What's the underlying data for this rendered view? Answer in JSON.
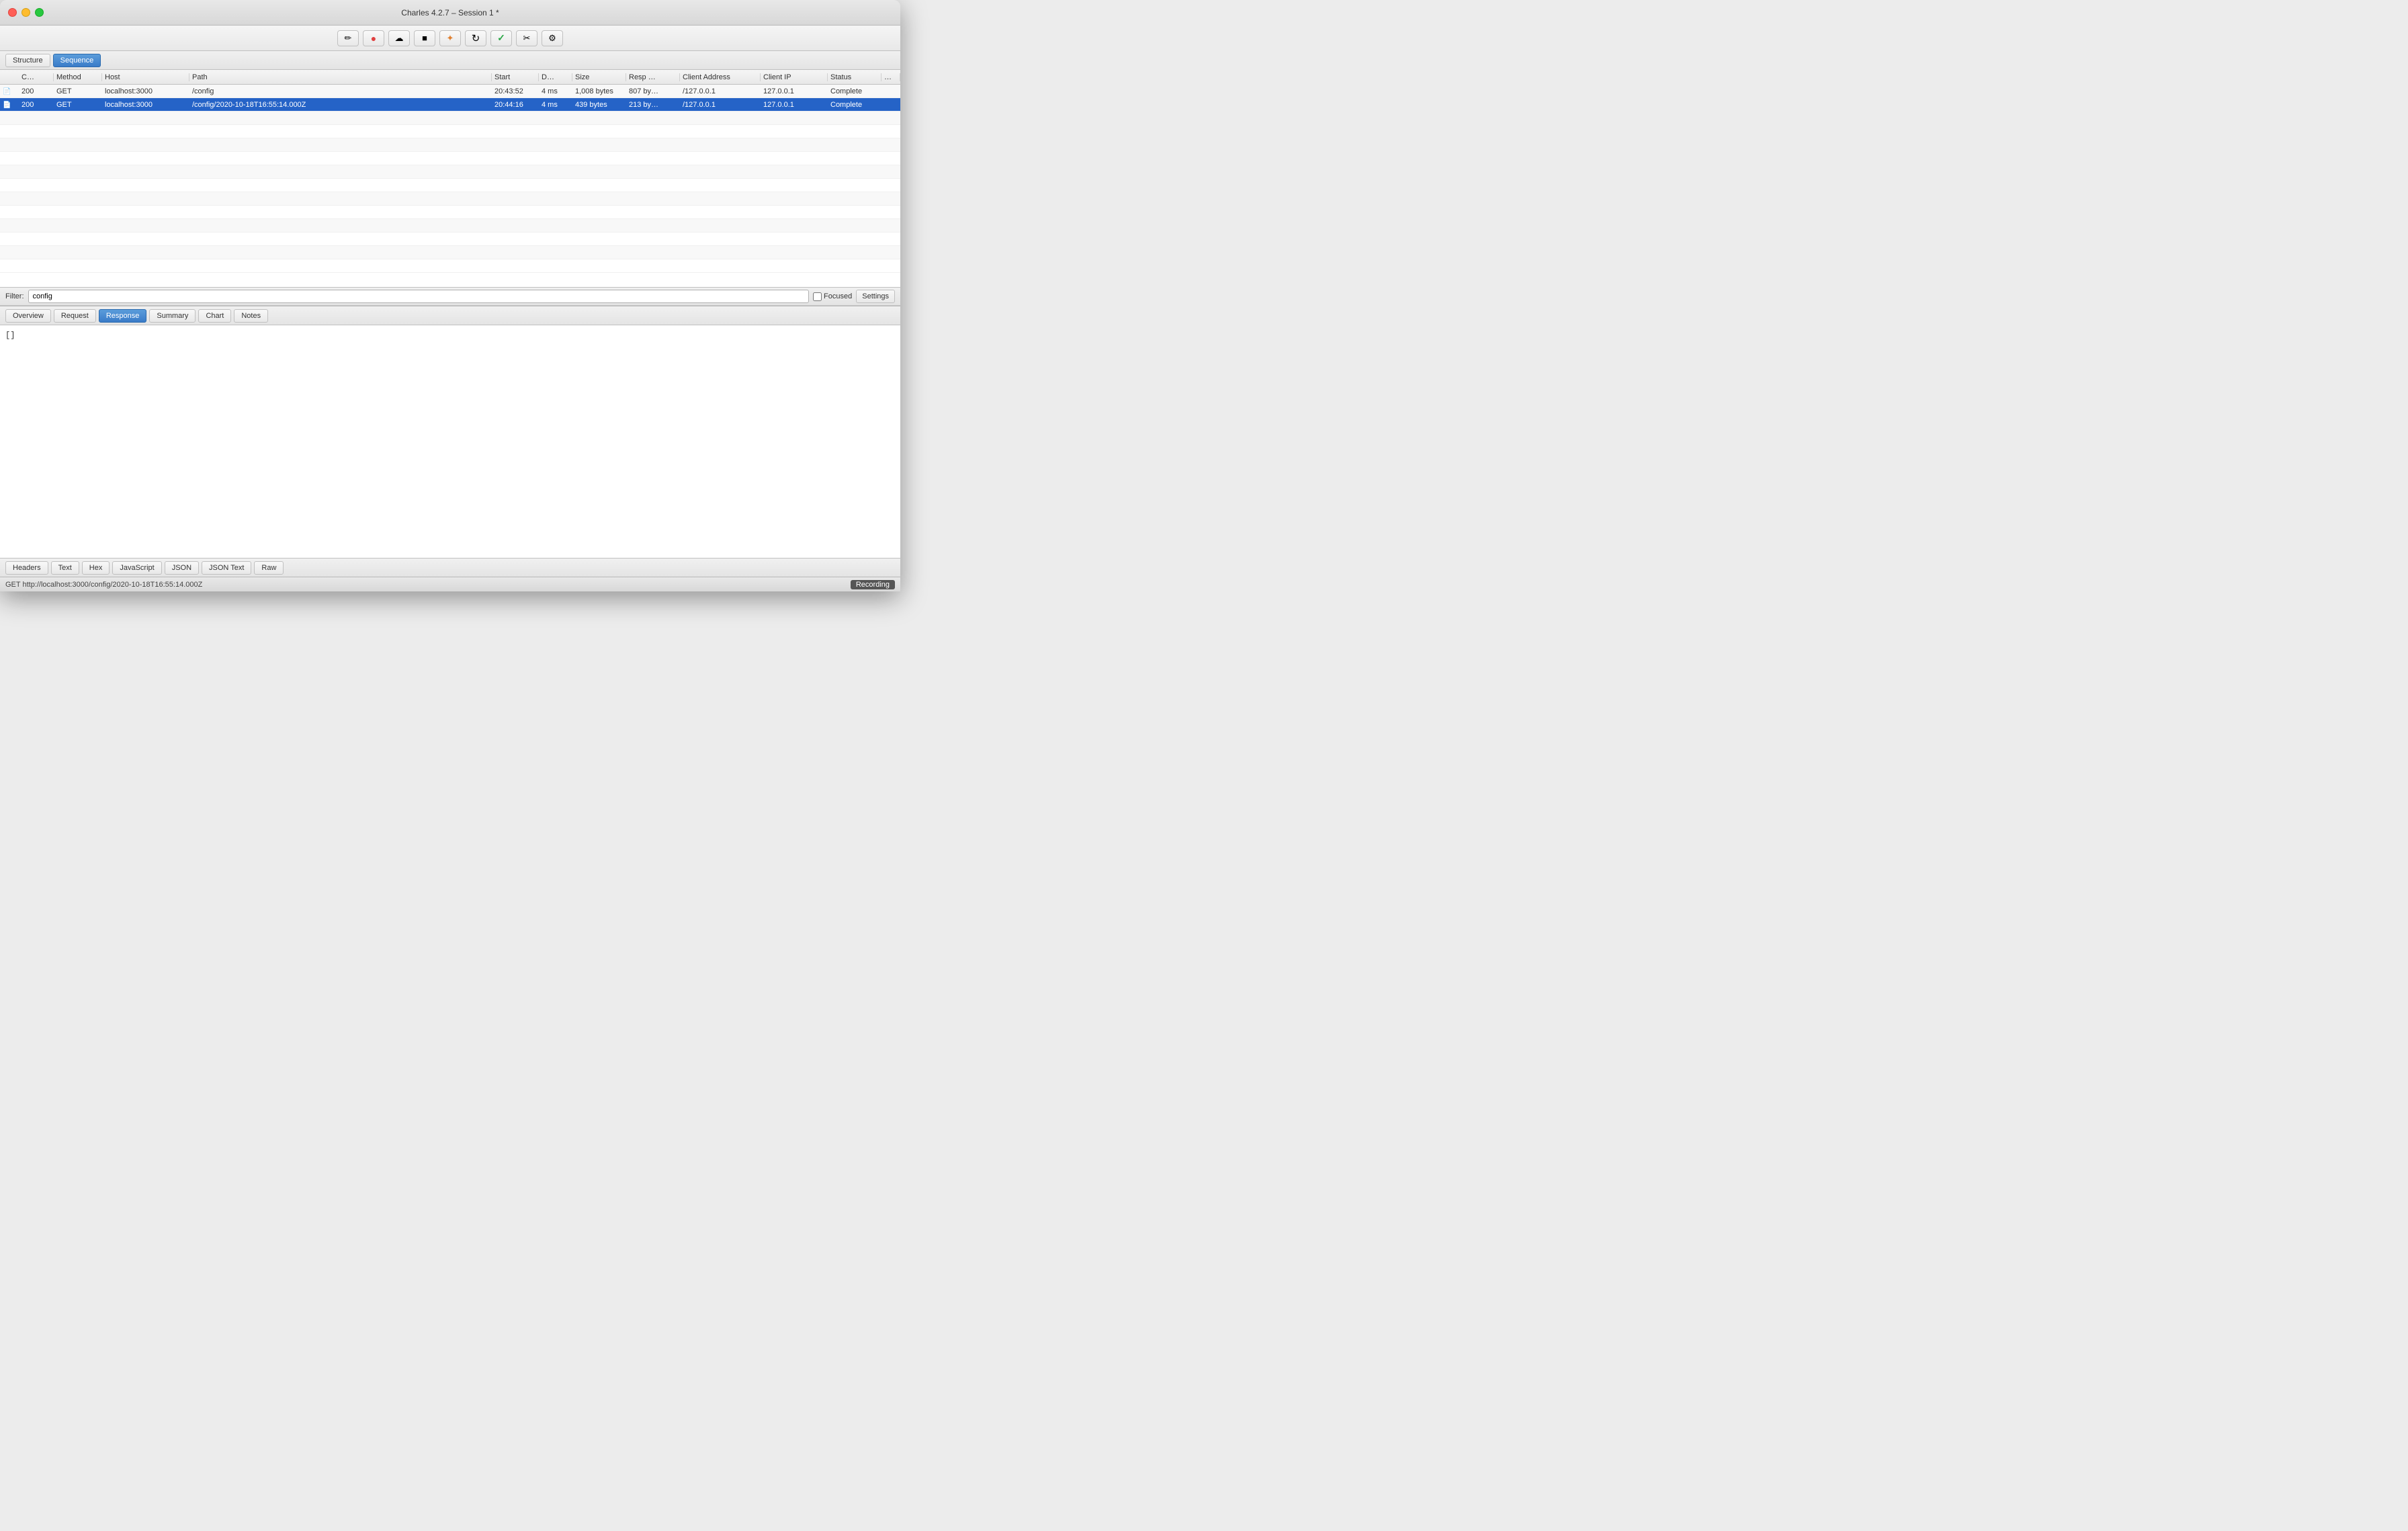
{
  "titlebar": {
    "title": "Charles 4.2.7 – Session 1 *"
  },
  "toolbar": {
    "buttons": [
      {
        "name": "pen-tool-icon",
        "symbol": "✏️",
        "label": "Pen Tool"
      },
      {
        "name": "record-icon",
        "symbol": "●",
        "label": "Record",
        "color": "#e04040"
      },
      {
        "name": "cloud-icon",
        "symbol": "☁",
        "label": "Cloud"
      },
      {
        "name": "stop-icon",
        "symbol": "■",
        "label": "Stop"
      },
      {
        "name": "feather-icon",
        "symbol": "✦",
        "label": "Feather"
      },
      {
        "name": "refresh-icon",
        "symbol": "↻",
        "label": "Refresh"
      },
      {
        "name": "check-icon",
        "symbol": "✓",
        "label": "Check",
        "color": "#28a745"
      },
      {
        "name": "tools-icon",
        "symbol": "✂",
        "label": "Tools"
      },
      {
        "name": "settings-icon",
        "symbol": "⚙",
        "label": "Settings"
      }
    ]
  },
  "view_tabs": {
    "structure_label": "Structure",
    "sequence_label": "Sequence"
  },
  "table": {
    "columns": [
      "",
      "C…",
      "Method",
      "Host",
      "Path",
      "Start",
      "D…",
      "Size",
      "Resp …",
      "Client Address",
      "Client IP",
      "Status",
      "…"
    ],
    "rows": [
      {
        "icon": "📄",
        "code": "200",
        "method": "GET",
        "host": "localhost:3000",
        "path": "/config",
        "start": "20:43:52",
        "duration": "4 ms",
        "size": "1,008 bytes",
        "response": "807 by…",
        "client_address": "/127.0.0.1",
        "client_ip": "127.0.0.1",
        "status": "Complete",
        "selected": false
      },
      {
        "icon": "📄",
        "code": "200",
        "method": "GET",
        "host": "localhost:3000",
        "path": "/config/2020-10-18T16:55:14.000Z",
        "start": "20:44:16",
        "duration": "4 ms",
        "size": "439 bytes",
        "response": "213 by…",
        "client_address": "/127.0.0.1",
        "client_ip": "127.0.0.1",
        "status": "Complete",
        "selected": true
      }
    ]
  },
  "filter": {
    "label": "Filter:",
    "value": "config",
    "focused_label": "Focused",
    "settings_label": "Settings"
  },
  "detail_tabs": {
    "overview_label": "Overview",
    "request_label": "Request",
    "response_label": "Response",
    "summary_label": "Summary",
    "chart_label": "Chart",
    "notes_label": "Notes",
    "active": "Response"
  },
  "detail_content": {
    "body": "[]"
  },
  "sub_tabs": {
    "headers_label": "Headers",
    "text_label": "Text",
    "hex_label": "Hex",
    "javascript_label": "JavaScript",
    "json_label": "JSON",
    "json_text_label": "JSON Text",
    "raw_label": "Raw"
  },
  "statusbar": {
    "request_url": "GET http://localhost:3000/config/2020-10-18T16:55:14.000Z",
    "recording_label": "Recording"
  }
}
